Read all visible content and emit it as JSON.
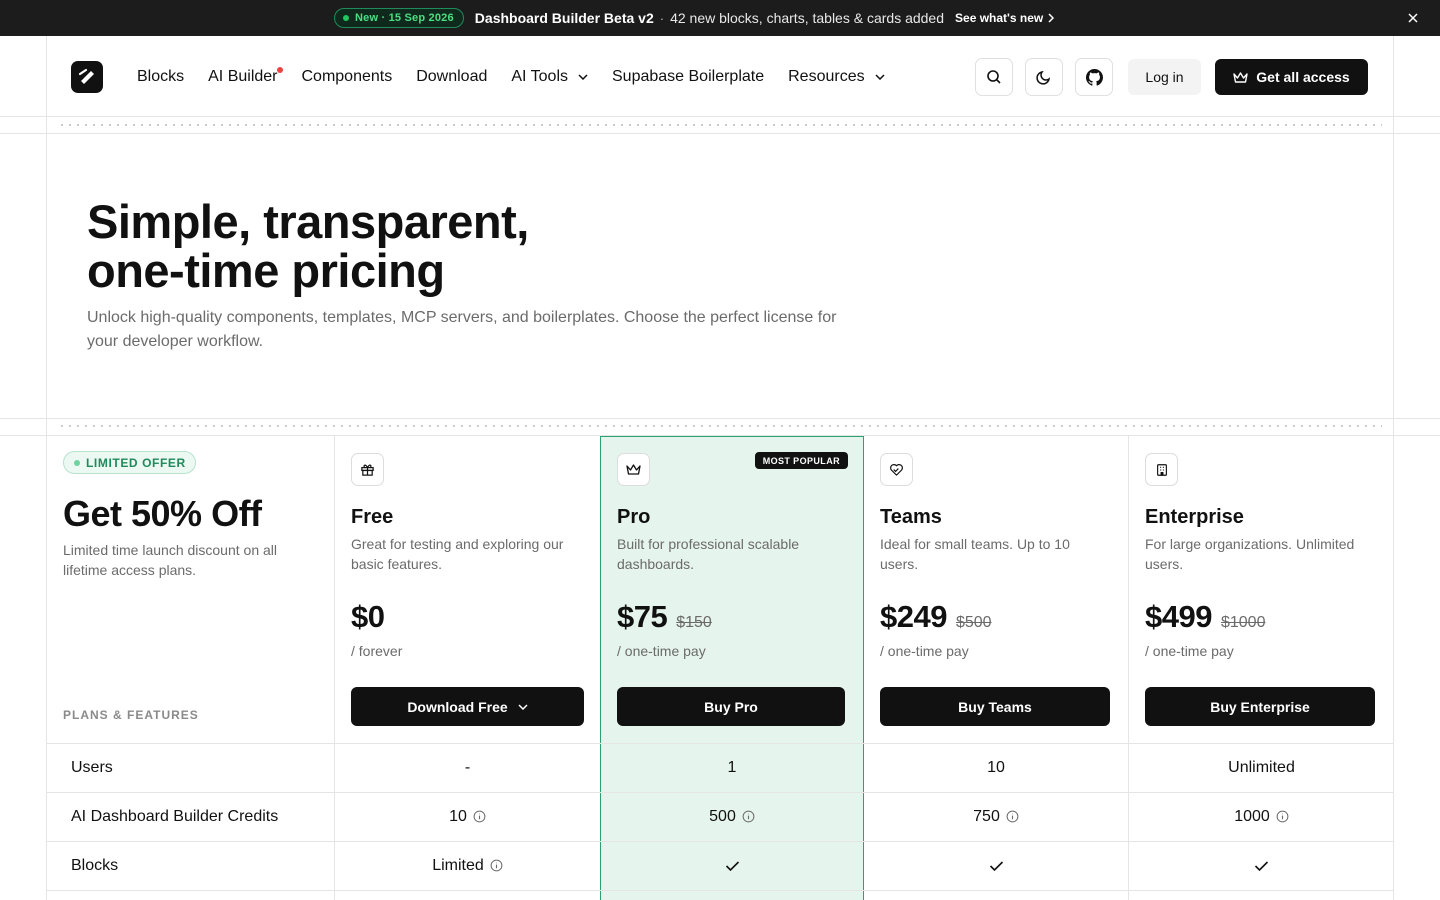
{
  "announcement": {
    "badge": "New · 15 Sep 2026",
    "title": "Dashboard Builder Beta v2",
    "separator": "·",
    "text": "42 new blocks, charts, tables & cards added",
    "link": "See what's new"
  },
  "nav": {
    "items": [
      "Blocks",
      "AI Builder",
      "Components",
      "Download",
      "AI Tools",
      "Supabase Boilerplate",
      "Resources"
    ],
    "login": "Log in",
    "cta": "Get all access"
  },
  "hero": {
    "title_line1": "Simple, transparent,",
    "title_line2": "one-time pricing",
    "subtitle": "Unlock high-quality components, templates, MCP servers, and boilerplates. Choose the perfect license for your developer workflow."
  },
  "offer": {
    "badge": "LIMITED OFFER",
    "title": "Get 50% Off",
    "subtitle": "Limited time launch discount on all lifetime access plans.",
    "plans_label": "PLANS & FEATURES"
  },
  "plans": [
    {
      "name": "Free",
      "desc": "Great for testing and exploring our basic features.",
      "price": "$0",
      "was": "",
      "term": "/  forever",
      "button": "Download Free",
      "icon": "gift-icon"
    },
    {
      "name": "Pro",
      "desc": "Built for professional scalable dashboards.",
      "price": "$75",
      "was": "$150",
      "term": "/  one-time pay",
      "button": "Buy Pro",
      "icon": "crown-icon",
      "badge": "MOST POPULAR"
    },
    {
      "name": "Teams",
      "desc": "Ideal for small teams. Up to 10 users.",
      "price": "$249",
      "was": "$500",
      "term": "/  one-time pay",
      "button": "Buy Teams",
      "icon": "heart-handshake-icon"
    },
    {
      "name": "Enterprise",
      "desc": "For large organizations. Unlimited users.",
      "price": "$499",
      "was": "$1000",
      "term": "/  one-time pay",
      "button": "Buy Enterprise",
      "icon": "building-icon"
    }
  ],
  "features": [
    {
      "label": "Users",
      "values": [
        "-",
        "1",
        "10",
        "Unlimited"
      ]
    },
    {
      "label": "AI Dashboard Builder Credits",
      "values": [
        "10",
        "500",
        "750",
        "1000"
      ]
    },
    {
      "label": "Blocks",
      "values": [
        "Limited",
        "check",
        "check",
        "check"
      ]
    }
  ],
  "colors": {
    "accent": "#1f8a5b",
    "pro_background": "#e6f4ee",
    "dark": "#111111"
  }
}
